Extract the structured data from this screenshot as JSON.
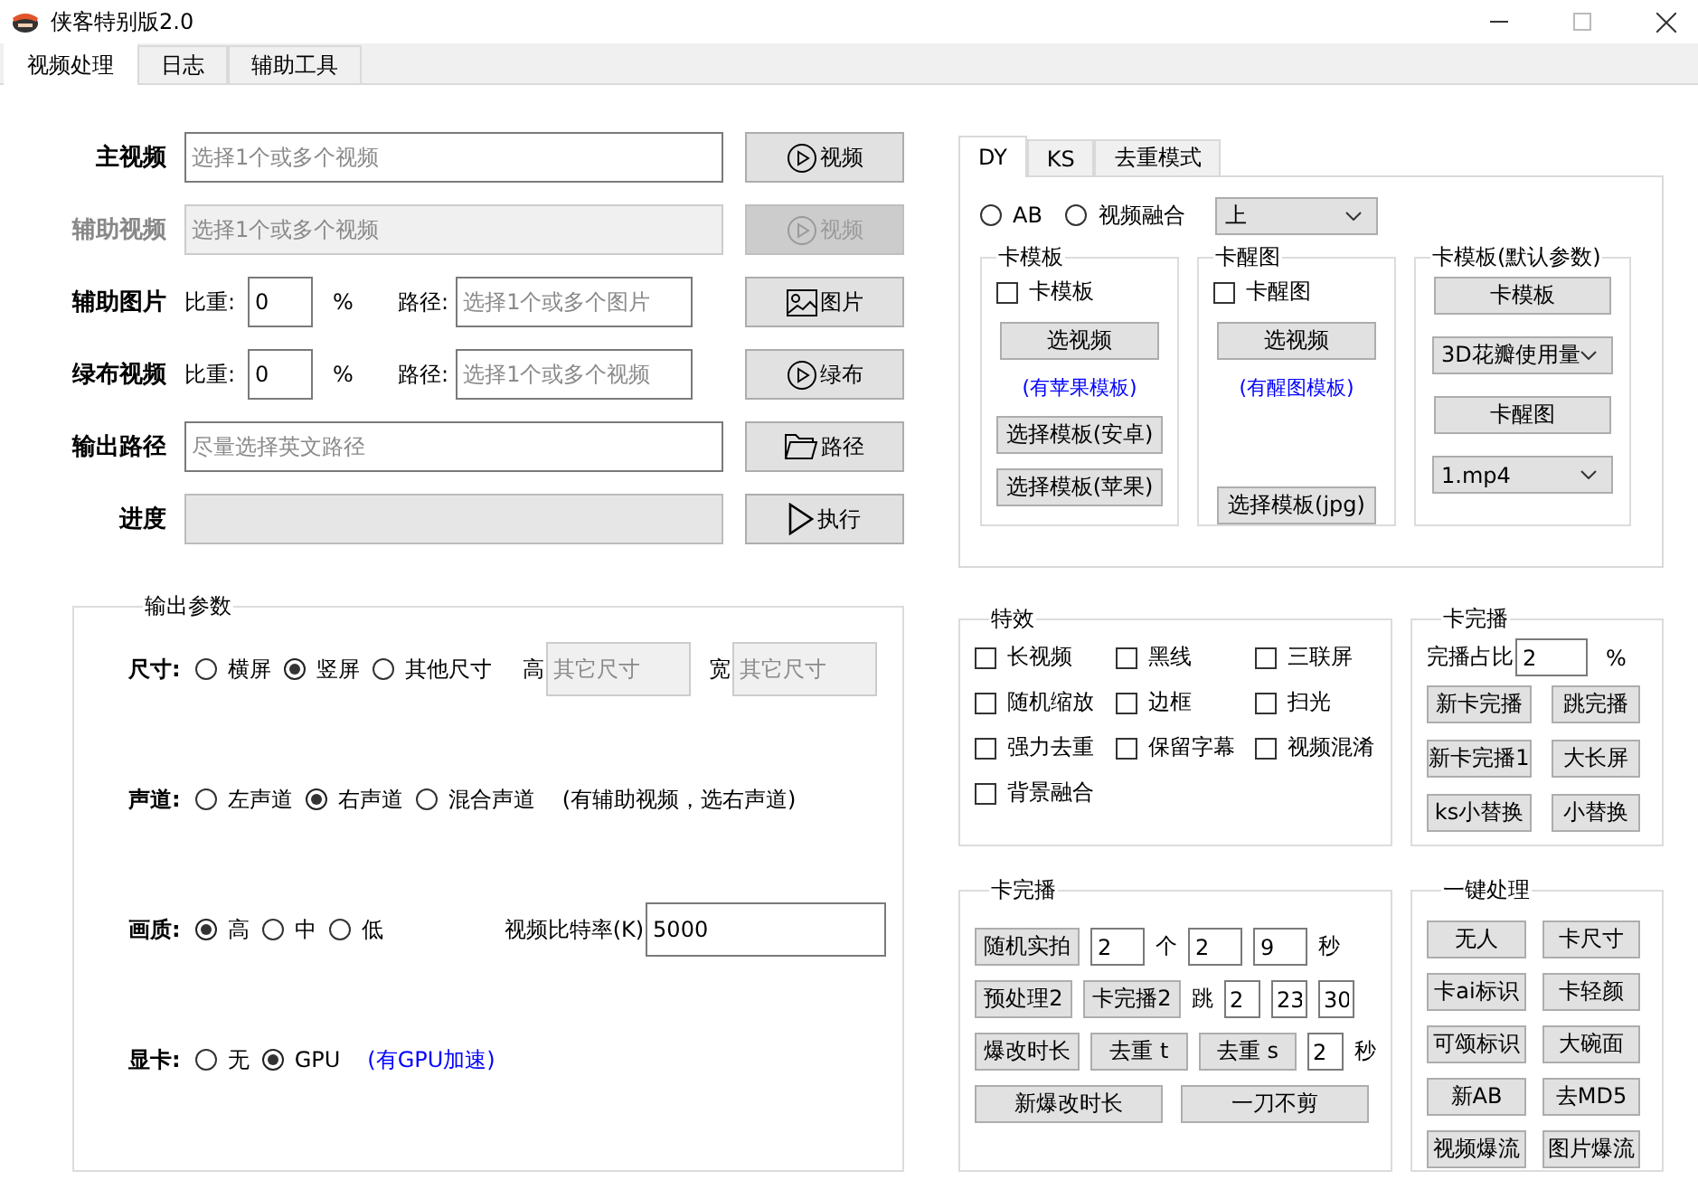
{
  "window": {
    "title": "侠客特别版2.0"
  },
  "tabs": [
    {
      "label": "视频处理",
      "selected": true
    },
    {
      "label": "日志",
      "selected": false
    },
    {
      "label": "辅助工具",
      "selected": false
    }
  ],
  "inputs": [
    {
      "kind": "file",
      "label": "主视频",
      "disabled": false,
      "placeholder": "选择1个或多个视频",
      "button": "视频"
    },
    {
      "kind": "file",
      "label": "辅助视频",
      "disabled": true,
      "placeholder": "选择1个或多个视频",
      "button": "视频"
    },
    {
      "kind": "weighted",
      "label": "辅助图片",
      "disabled": false,
      "weight_label": "比重:",
      "weight": "0",
      "unit": "%",
      "path_label": "路径:",
      "placeholder": "选择1个或多个图片",
      "button": "图片"
    },
    {
      "kind": "weighted",
      "label": "绿布视频",
      "disabled": false,
      "weight_label": "比重:",
      "weight": "0",
      "unit": "%",
      "path_label": "路径:",
      "placeholder": "选择1个或多个视频",
      "button": "绿布"
    },
    {
      "kind": "file",
      "label": "输出路径",
      "disabled": false,
      "placeholder": "尽量选择英文路径",
      "button": "路径"
    },
    {
      "kind": "progress",
      "label": "进度",
      "disabled": false,
      "level": 0,
      "button": "执行"
    }
  ],
  "output_params": {
    "title": "输出参数",
    "rows": [
      {
        "label": "尺寸:",
        "options": [
          {
            "label": "横屏",
            "selected": false
          },
          {
            "label": "竖屏",
            "selected": true
          },
          {
            "label": "其他尺寸",
            "selected": false
          }
        ],
        "fields": [
          {
            "label": "高",
            "placeholder": "其它尺寸",
            "disabled": true
          },
          {
            "label": "宽",
            "placeholder": "其它尺寸",
            "disabled": true
          }
        ]
      },
      {
        "label": "声道:",
        "options": [
          {
            "label": "左声道",
            "selected": false
          },
          {
            "label": "右声道",
            "selected": true
          },
          {
            "label": "混合声道",
            "selected": false
          }
        ],
        "note": {
          "text": "(有辅助视频，选右声道)",
          "color": "#000000"
        }
      },
      {
        "label": "画质:",
        "options": [
          {
            "label": "高",
            "selected": true
          },
          {
            "label": "中",
            "selected": false
          },
          {
            "label": "低",
            "selected": false
          }
        ],
        "fields": [
          {
            "label": "视频比特率(K)",
            "value": "5000",
            "disabled": false
          }
        ]
      },
      {
        "label": "显卡:",
        "options": [
          {
            "label": "无",
            "selected": false
          },
          {
            "label": "GPU",
            "selected": true
          }
        ],
        "note": {
          "text": "(有GPU加速)",
          "color": "#0000ff"
        }
      }
    ]
  },
  "platform_tabs": [
    {
      "label": "DY",
      "selected": true
    },
    {
      "label": "KS",
      "selected": false
    },
    {
      "label": "去重模式",
      "selected": false
    }
  ],
  "dy": {
    "radios": [
      {
        "label": "AB",
        "selected": false
      },
      {
        "label": "视频融合",
        "selected": false
      }
    ],
    "dropdown": "上",
    "groups": [
      {
        "title": "卡模板",
        "checkbox": {
          "label": "卡模板",
          "checked": false
        },
        "items": [
          {
            "kind": "button",
            "label": "选视频"
          },
          {
            "kind": "note",
            "label": "(有苹果模板)"
          },
          {
            "kind": "button",
            "label": "选择模板(安卓)"
          },
          {
            "kind": "button",
            "label": "选择模板(苹果)"
          }
        ]
      },
      {
        "title": "卡醒图",
        "checkbox": {
          "label": "卡醒图",
          "checked": false
        },
        "items": [
          {
            "kind": "button",
            "label": "选视频"
          },
          {
            "kind": "note",
            "label": "(有醒图模板)"
          },
          {
            "kind": "spacer"
          },
          {
            "kind": "button",
            "label": "选择模板(jpg)"
          }
        ]
      },
      {
        "title": "卡模板(默认参数)",
        "items": [
          {
            "kind": "button",
            "label": "卡模板"
          },
          {
            "kind": "select",
            "label": "3D花瓣使用量"
          },
          {
            "kind": "button",
            "label": "卡醒图"
          },
          {
            "kind": "select",
            "label": "1.mp4"
          }
        ]
      }
    ]
  },
  "effects": {
    "title": "特效",
    "items": [
      {
        "label": "长视频",
        "checked": false
      },
      {
        "label": "黑线",
        "checked": false
      },
      {
        "label": "三联屏",
        "checked": false
      },
      {
        "label": "随机缩放",
        "checked": false
      },
      {
        "label": "边框",
        "checked": false
      },
      {
        "label": "扫光",
        "checked": false
      },
      {
        "label": "强力去重",
        "checked": false
      },
      {
        "label": "保留字幕",
        "checked": false
      },
      {
        "label": "视频混淆",
        "checked": false
      },
      {
        "label": "背景融合",
        "checked": false
      }
    ]
  },
  "finish_ratio": {
    "title": "卡完播",
    "label": "完播占比",
    "value": "2",
    "unit": "%",
    "buttons": [
      "新卡完播",
      "跳完播",
      "新卡完播1",
      "大长屏",
      "ks小替换",
      "小替换"
    ]
  },
  "finish_tools": {
    "title": "卡完播",
    "rows": [
      {
        "items": [
          {
            "kind": "button",
            "label": "随机实拍"
          },
          {
            "kind": "field",
            "label": "2"
          },
          {
            "kind": "text",
            "label": "个"
          },
          {
            "kind": "field",
            "label": "2"
          },
          {
            "kind": "field",
            "label": "9"
          },
          {
            "kind": "text",
            "label": "秒"
          }
        ]
      },
      {
        "items": [
          {
            "kind": "button",
            "label": "预处理2"
          },
          {
            "kind": "button",
            "label": "卡完播2"
          },
          {
            "kind": "text",
            "label": "跳"
          },
          {
            "kind": "small",
            "label": "2"
          },
          {
            "kind": "small",
            "label": "23"
          },
          {
            "kind": "small",
            "label": "30"
          }
        ]
      },
      {
        "items": [
          {
            "kind": "button",
            "label": "爆改时长"
          },
          {
            "kind": "button",
            "label": "去重 t"
          },
          {
            "kind": "button",
            "label": "去重 s"
          },
          {
            "kind": "small",
            "label": "2"
          },
          {
            "kind": "text",
            "label": "秒"
          }
        ]
      },
      {
        "items": [
          {
            "kind": "wide",
            "label": "新爆改时长"
          },
          {
            "kind": "wide",
            "label": "一刀不剪"
          }
        ]
      }
    ]
  },
  "one_click": {
    "title": "一键处理",
    "buttons": [
      "无人",
      "卡尺寸",
      "卡ai标识",
      "卡轻颜",
      "可颂标识",
      "大碗面",
      "新AB",
      "去MD5",
      "视频爆流",
      "图片爆流"
    ]
  }
}
